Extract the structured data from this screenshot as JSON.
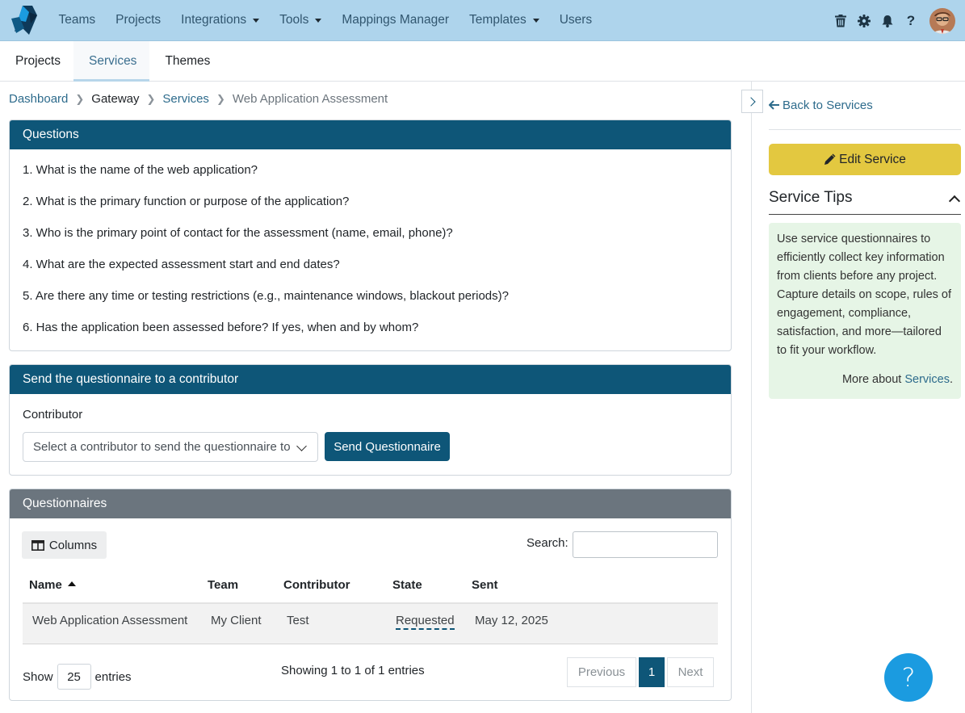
{
  "topnav": {
    "items": [
      {
        "label": "Teams",
        "dropdown": false
      },
      {
        "label": "Projects",
        "dropdown": false
      },
      {
        "label": "Integrations",
        "dropdown": true
      },
      {
        "label": "Tools",
        "dropdown": true
      },
      {
        "label": "Mappings Manager",
        "dropdown": false
      },
      {
        "label": "Templates",
        "dropdown": true
      },
      {
        "label": "Users",
        "dropdown": false
      }
    ],
    "icons": [
      "trash-icon",
      "gear-icon",
      "bell-icon",
      "help-icon"
    ],
    "help_glyph": "?"
  },
  "subnav": {
    "tabs": [
      {
        "label": "Projects",
        "active": false
      },
      {
        "label": "Services",
        "active": true
      },
      {
        "label": "Themes",
        "active": false
      }
    ]
  },
  "breadcrumb": {
    "dashboard": "Dashboard",
    "gateway": "Gateway",
    "services": "Services",
    "current": "Web Application Assessment"
  },
  "questions": {
    "title": "Questions",
    "items": [
      "1. What is the name of the web application?",
      "2. What is the primary function or purpose of the application?",
      "3. Who is the primary point of contact for the assessment (name, email, phone)?",
      "4. What are the expected assessment start and end dates?",
      "5. Are there any time or testing restrictions (e.g., maintenance windows, blackout periods)?",
      "6. Has the application been assessed before? If yes, when and by whom?"
    ]
  },
  "send": {
    "title": "Send the questionnaire to a contributor",
    "label": "Contributor",
    "select_placeholder": "Select a contributor to send the questionnaire to",
    "button": "Send Questionnaire"
  },
  "questionnaires": {
    "title": "Questionnaires",
    "columns_button": "Columns",
    "search_label": "Search:",
    "headers": {
      "name": "Name",
      "team": "Team",
      "contributor": "Contributor",
      "state": "State",
      "sent": "Sent"
    },
    "rows": [
      {
        "name": "Web Application Assessment",
        "team": "My Client",
        "contributor": "Test",
        "state": "Requested",
        "sent": "May 12, 2025"
      }
    ],
    "show_label": "Show",
    "show_value": "25",
    "entries_label": "entries",
    "info": "Showing 1 to 1 of 1 entries",
    "prev": "Previous",
    "page": "1",
    "next": "Next"
  },
  "sidebar": {
    "back": "Back to Services",
    "edit": "Edit Service",
    "tips_title": "Service Tips",
    "tips_text": "Use service questionnaires to efficiently collect key information from clients before any project. Capture details on scope, rules of engagement, compliance, satisfaction, and more—tailored to fit your workflow.",
    "more_prefix": "More about",
    "more_link": "Services",
    "more_suffix": "."
  },
  "help_button": "?",
  "colors": {
    "navbar": "#aed4ec",
    "primary": "#0e5678",
    "card_gray": "#6b757e",
    "edit_button": "#e3c840",
    "tips_bg": "#e6f5e6",
    "help_button": "#1b9be0"
  }
}
